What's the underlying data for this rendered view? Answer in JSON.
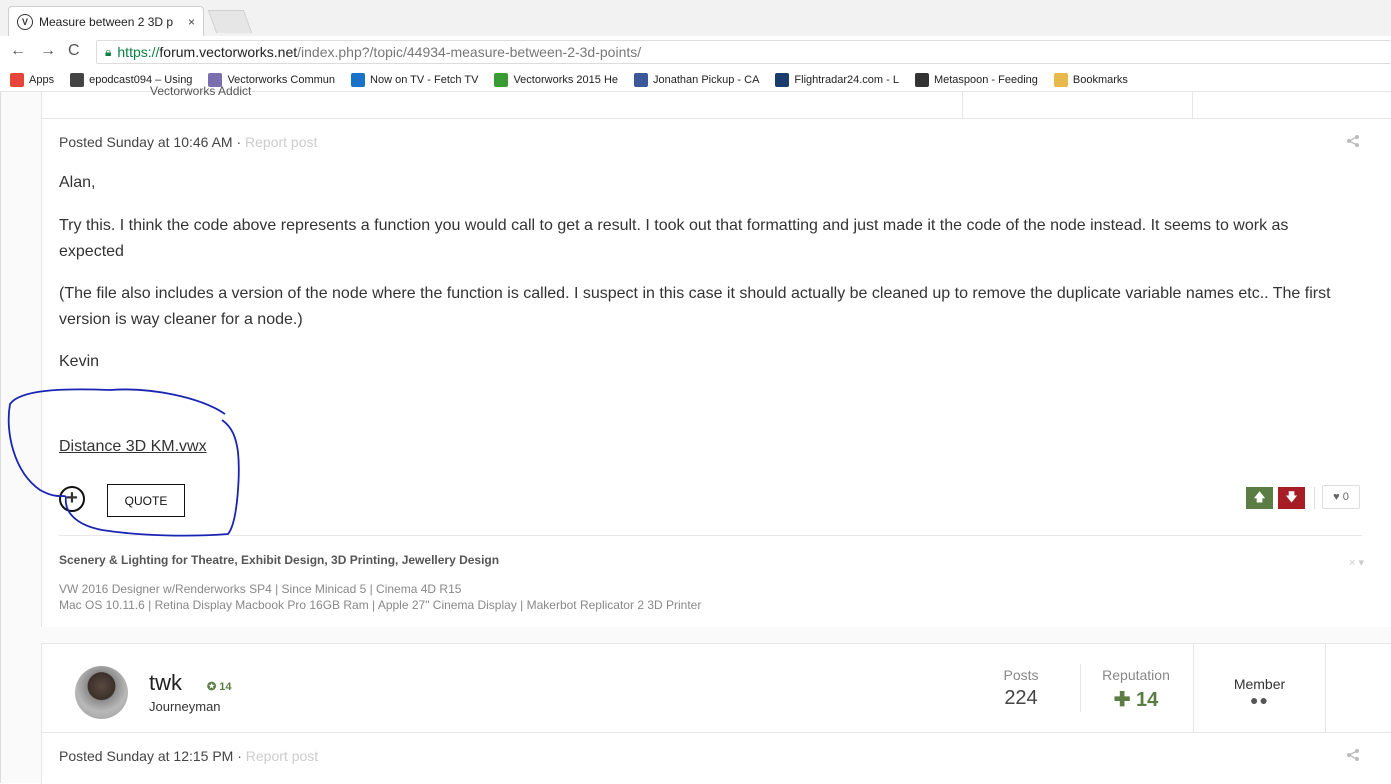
{
  "browser": {
    "tab_title": "Measure between 2 3D p",
    "tab_close": "×",
    "favicon": "V",
    "nav": {
      "back": "←",
      "forward": "→",
      "reload": "C"
    },
    "url_scheme": "https://",
    "url_host": "forum.vectorworks.net",
    "url_path": "/index.php?/topic/44934-measure-between-2-3d-points/",
    "bookmarks": [
      {
        "label": "Apps",
        "icon": "apps-grid-icon",
        "color": "#e8453c"
      },
      {
        "label": "epodcast094 – Using",
        "icon": "podcast-icon",
        "color": "#444444"
      },
      {
        "label": "Vectorworks Commun",
        "icon": "vectorworks-icon",
        "color": "#7b6fb0"
      },
      {
        "label": "Now on TV - Fetch TV",
        "icon": "tv-icon",
        "color": "#1a73c8"
      },
      {
        "label": "Vectorworks 2015 He",
        "icon": "help-icon",
        "color": "#3a9b35"
      },
      {
        "label": "Jonathan Pickup - CA",
        "icon": "facebook-icon",
        "color": "#3b5998"
      },
      {
        "label": "Flightradar24.com - L",
        "icon": "globe-icon",
        "color": "#1b3d6d"
      },
      {
        "label": "Metaspoon - Feeding",
        "icon": "metaspoon-icon",
        "color": "#333333"
      },
      {
        "label": "Bookmarks",
        "icon": "folder-icon",
        "color": "#e8b94a"
      }
    ]
  },
  "previous_header_cut": "Vectorworks Addict",
  "post": {
    "posted": "Posted Sunday at 10:46 AM ·",
    "report": "Report post",
    "share_icon": "share-icon",
    "paragraphs": [
      "Alan,",
      "Try this. I think the code above represents a function you would call to get a result. I took out that formatting and just made it the code of the node instead. It seems to work as expected",
      "(The file also includes a version of the node where the function is called. I suspect in this case it should actually be cleaned up to remove the duplicate variable names etc.. The first version is way cleaner for a node.)",
      "Kevin"
    ],
    "attachment": "Distance 3D KM.vwx",
    "multiquote": "+",
    "quote_label": "QUOTE",
    "vote_up": "🡅",
    "vote_down": "🡇",
    "like_count": "♥ 0",
    "signature": {
      "title": "Scenery & Lighting for Theatre, Exhibit Design, 3D Printing, Jewellery Design",
      "lines": [
        "VW 2016 Designer w/Renderworks SP4 | Since Minicad 5 | Cinema 4D R15",
        "Mac OS 10.11.6 | Retina Display Macbook Pro 16GB Ram | Apple 27\" Cinema Display | Makerbot Replicator 2 3D Printer"
      ],
      "close": "× ▾"
    },
    "annotation_color": "#1a24b4"
  },
  "next_post": {
    "author": "twk",
    "rep_badge": "✪ 14",
    "rank": "Journeyman",
    "stats": {
      "posts_label": "Posts",
      "posts_value": "224",
      "rep_label": "Reputation",
      "rep_value": "✚ 14",
      "member_label": "Member",
      "member_dots": "●●"
    },
    "posted": "Posted Sunday at 12:15 PM ·",
    "report": "Report post"
  }
}
